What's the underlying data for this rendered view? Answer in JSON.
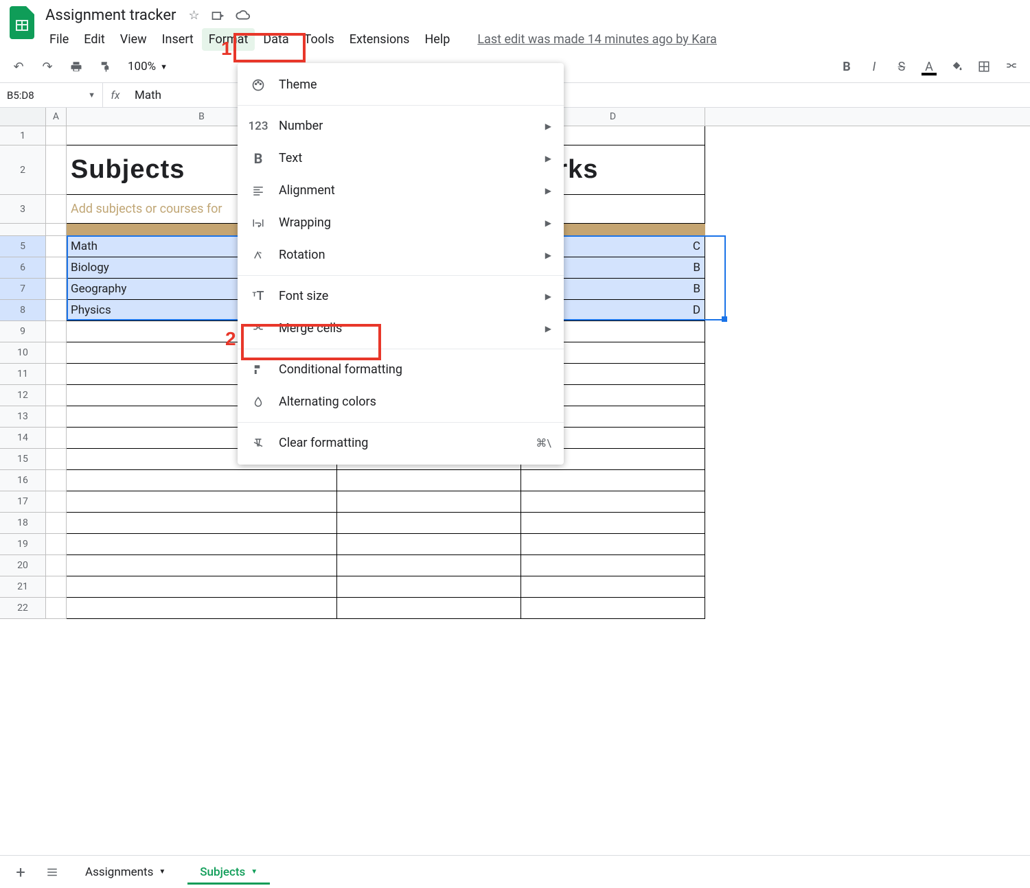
{
  "doc": {
    "title": "Assignment tracker",
    "last_edit": "Last edit was made 14 minutes ago by Kara"
  },
  "menu": {
    "file": "File",
    "edit": "Edit",
    "view": "View",
    "insert": "Insert",
    "format": "Format",
    "data": "Data",
    "tools": "Tools",
    "extensions": "Extensions",
    "help": "Help"
  },
  "toolbar": {
    "zoom": "100%"
  },
  "namebox": {
    "ref": "B5:D8",
    "formula": "Math"
  },
  "columns": {
    "A": "A",
    "B": "B",
    "D": "D"
  },
  "sheet": {
    "r2_b": "Subjects",
    "r2_d": "narks",
    "r3_b": "Add subjects or courses for",
    "r5_b": "Math",
    "r5_d": "C",
    "r6_b": "Biology",
    "r6_d": "B",
    "r7_b": "Geography",
    "r7_d": "B",
    "r8_b": "Physics",
    "r8_d": "D"
  },
  "rows": [
    "1",
    "2",
    "3",
    "5",
    "6",
    "7",
    "8",
    "9",
    "10",
    "11",
    "12",
    "13",
    "14",
    "15",
    "16",
    "17",
    "18",
    "19",
    "20",
    "21",
    "22"
  ],
  "dropdown": {
    "theme": "Theme",
    "number": "Number",
    "text": "Text",
    "align": "Alignment",
    "wrap": "Wrapping",
    "rotate": "Rotation",
    "fontsize": "Font size",
    "merge": "Merge cells",
    "cond": "Conditional formatting",
    "alt": "Alternating colors",
    "clear": "Clear formatting",
    "clear_sc": "⌘\\"
  },
  "tabs": {
    "assignments": "Assignments",
    "subjects": "Subjects"
  },
  "annot": {
    "n1": "1",
    "n2": "2"
  }
}
